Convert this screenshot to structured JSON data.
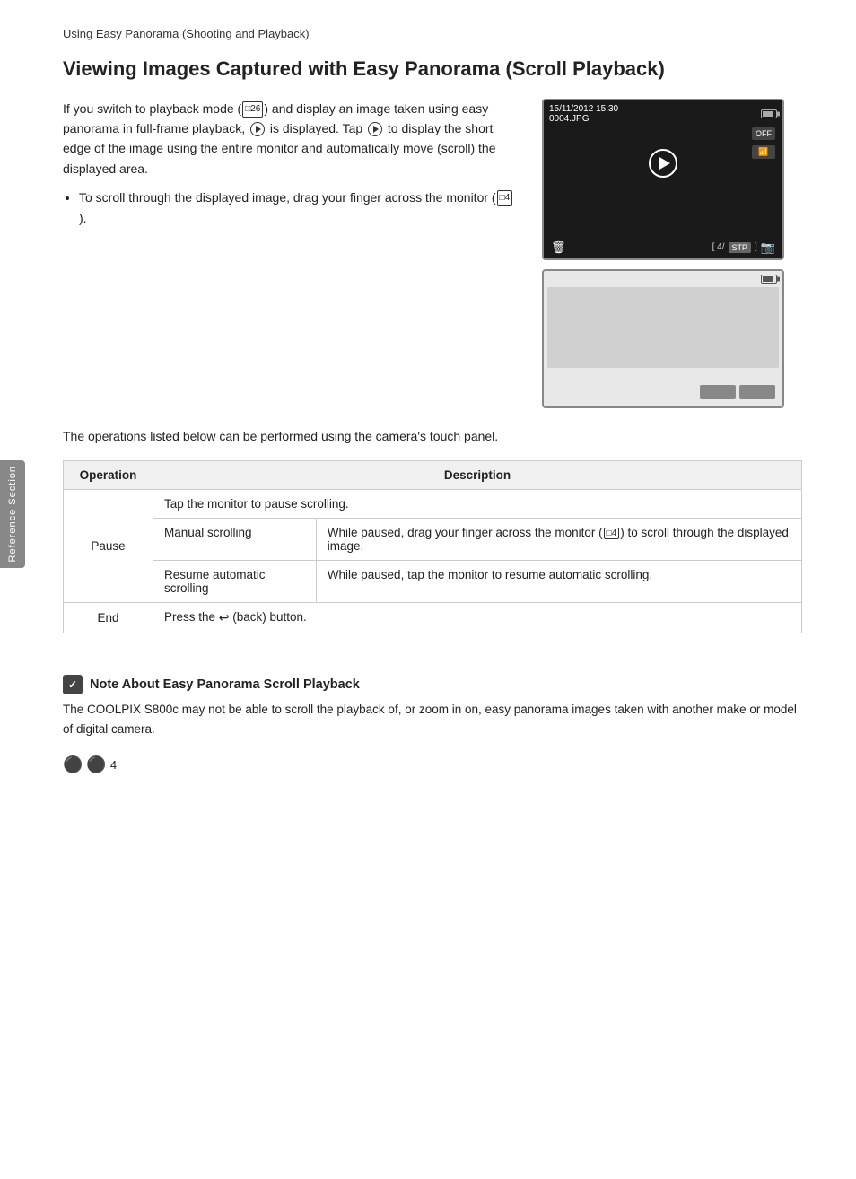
{
  "breadcrumb": "Using Easy Panorama (Shooting and Playback)",
  "title": "Viewing Images Captured with Easy Panorama (Scroll Playback)",
  "intro_p1": "If you switch to playback mode (",
  "intro_ref1": "26",
  "intro_p1b": ") and display an image taken using easy panorama in full-frame playback,",
  "intro_p2": "is displayed. Tap",
  "intro_p2b": "to display the short edge of the image using the entire monitor and automatically move (scroll) the displayed area.",
  "bullet1": "To scroll through the displayed image, drag your finger across the monitor (",
  "bullet1_ref": "4",
  "bullet1b": ").",
  "cam1": {
    "datetime": "15/11/2012 15:30",
    "filename": "0004.JPG"
  },
  "operations_note": "The operations listed below can be performed using the camera's touch panel.",
  "table": {
    "col_operation": "Operation",
    "col_description": "Description",
    "rows": [
      {
        "operation": "Pause",
        "rows": [
          {
            "left": "Tap the monitor to pause scrolling.",
            "right": ""
          },
          {
            "left": "Manual scrolling",
            "right": "While paused, drag your finger across the monitor (□4) to scroll through the displayed image."
          },
          {
            "left": "Resume automatic scrolling",
            "right": "While paused, tap the monitor to resume automatic scrolling."
          }
        ]
      },
      {
        "operation": "End",
        "rows": [
          {
            "left": "Press the ↵ (back) button.",
            "right": ""
          }
        ]
      }
    ]
  },
  "reference_label": "Reference Section",
  "note_title": "Note About Easy Panorama Scroll Playback",
  "note_body": "The COOLPIX S800c may not be able to scroll the playback of, or zoom in on, easy panorama images taken with another make or model of digital camera.",
  "footer_num": "4",
  "table_pause_tap": "Tap the monitor to pause scrolling.",
  "table_manual_label": "Manual scrolling",
  "table_manual_desc": "While paused, drag your finger across the monitor (□4) to scroll through the displayed image.",
  "table_resume_label": "Resume automatic scrolling",
  "table_resume_desc": "While paused, tap the monitor to resume automatic scrolling.",
  "table_end_label": "End",
  "table_end_desc_pre": "Press the",
  "table_end_desc_post": "(back) button.",
  "table_pause_label": "Pause"
}
